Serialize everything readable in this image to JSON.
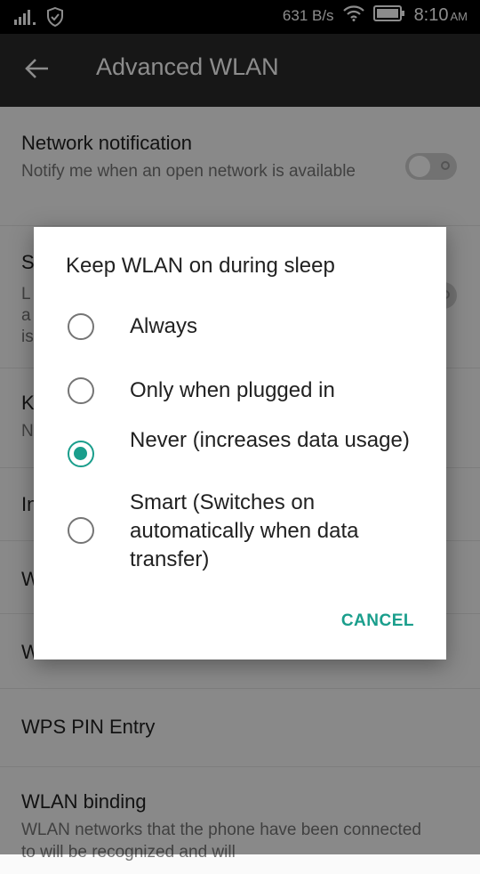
{
  "status_bar": {
    "network_speed": "631 B/s",
    "time": "8:10",
    "ampm": "AM",
    "icons": [
      "signal-icon",
      "shield-icon",
      "wifi-icon",
      "battery-icon"
    ]
  },
  "toolbar": {
    "title": "Advanced WLAN",
    "back_icon": "arrow-back-icon"
  },
  "settings": {
    "network_notification": {
      "title": "Network notification",
      "subtitle": "Notify me when an open network is available",
      "toggle_on": false
    },
    "row2": {
      "title": "S",
      "subtitle_lines": [
        "L",
        "a",
        "is"
      ]
    },
    "row3": {
      "title": "K",
      "subtitle": "N"
    },
    "row4": {
      "title": "In"
    },
    "row5": {
      "title": "W"
    },
    "row6": {
      "title": "W"
    },
    "wps_pin": {
      "title": "WPS PIN Entry"
    },
    "wlan_binding": {
      "title": "WLAN binding",
      "subtitle": "WLAN networks that the phone have been connected to will be recognized and will"
    }
  },
  "dialog": {
    "title": "Keep WLAN on during sleep",
    "options": [
      {
        "label": "Always",
        "checked": false
      },
      {
        "label": "Only when plugged in",
        "checked": false
      },
      {
        "label": "Never (increases data usage)",
        "checked": true
      },
      {
        "label": "Smart (Switches on automatically when data transfer)",
        "checked": false
      }
    ],
    "cancel_label": "CANCEL"
  },
  "colors": {
    "accent": "#1a9e8c",
    "toolbar": "#2a2a2a",
    "status_bar": "#000000"
  }
}
